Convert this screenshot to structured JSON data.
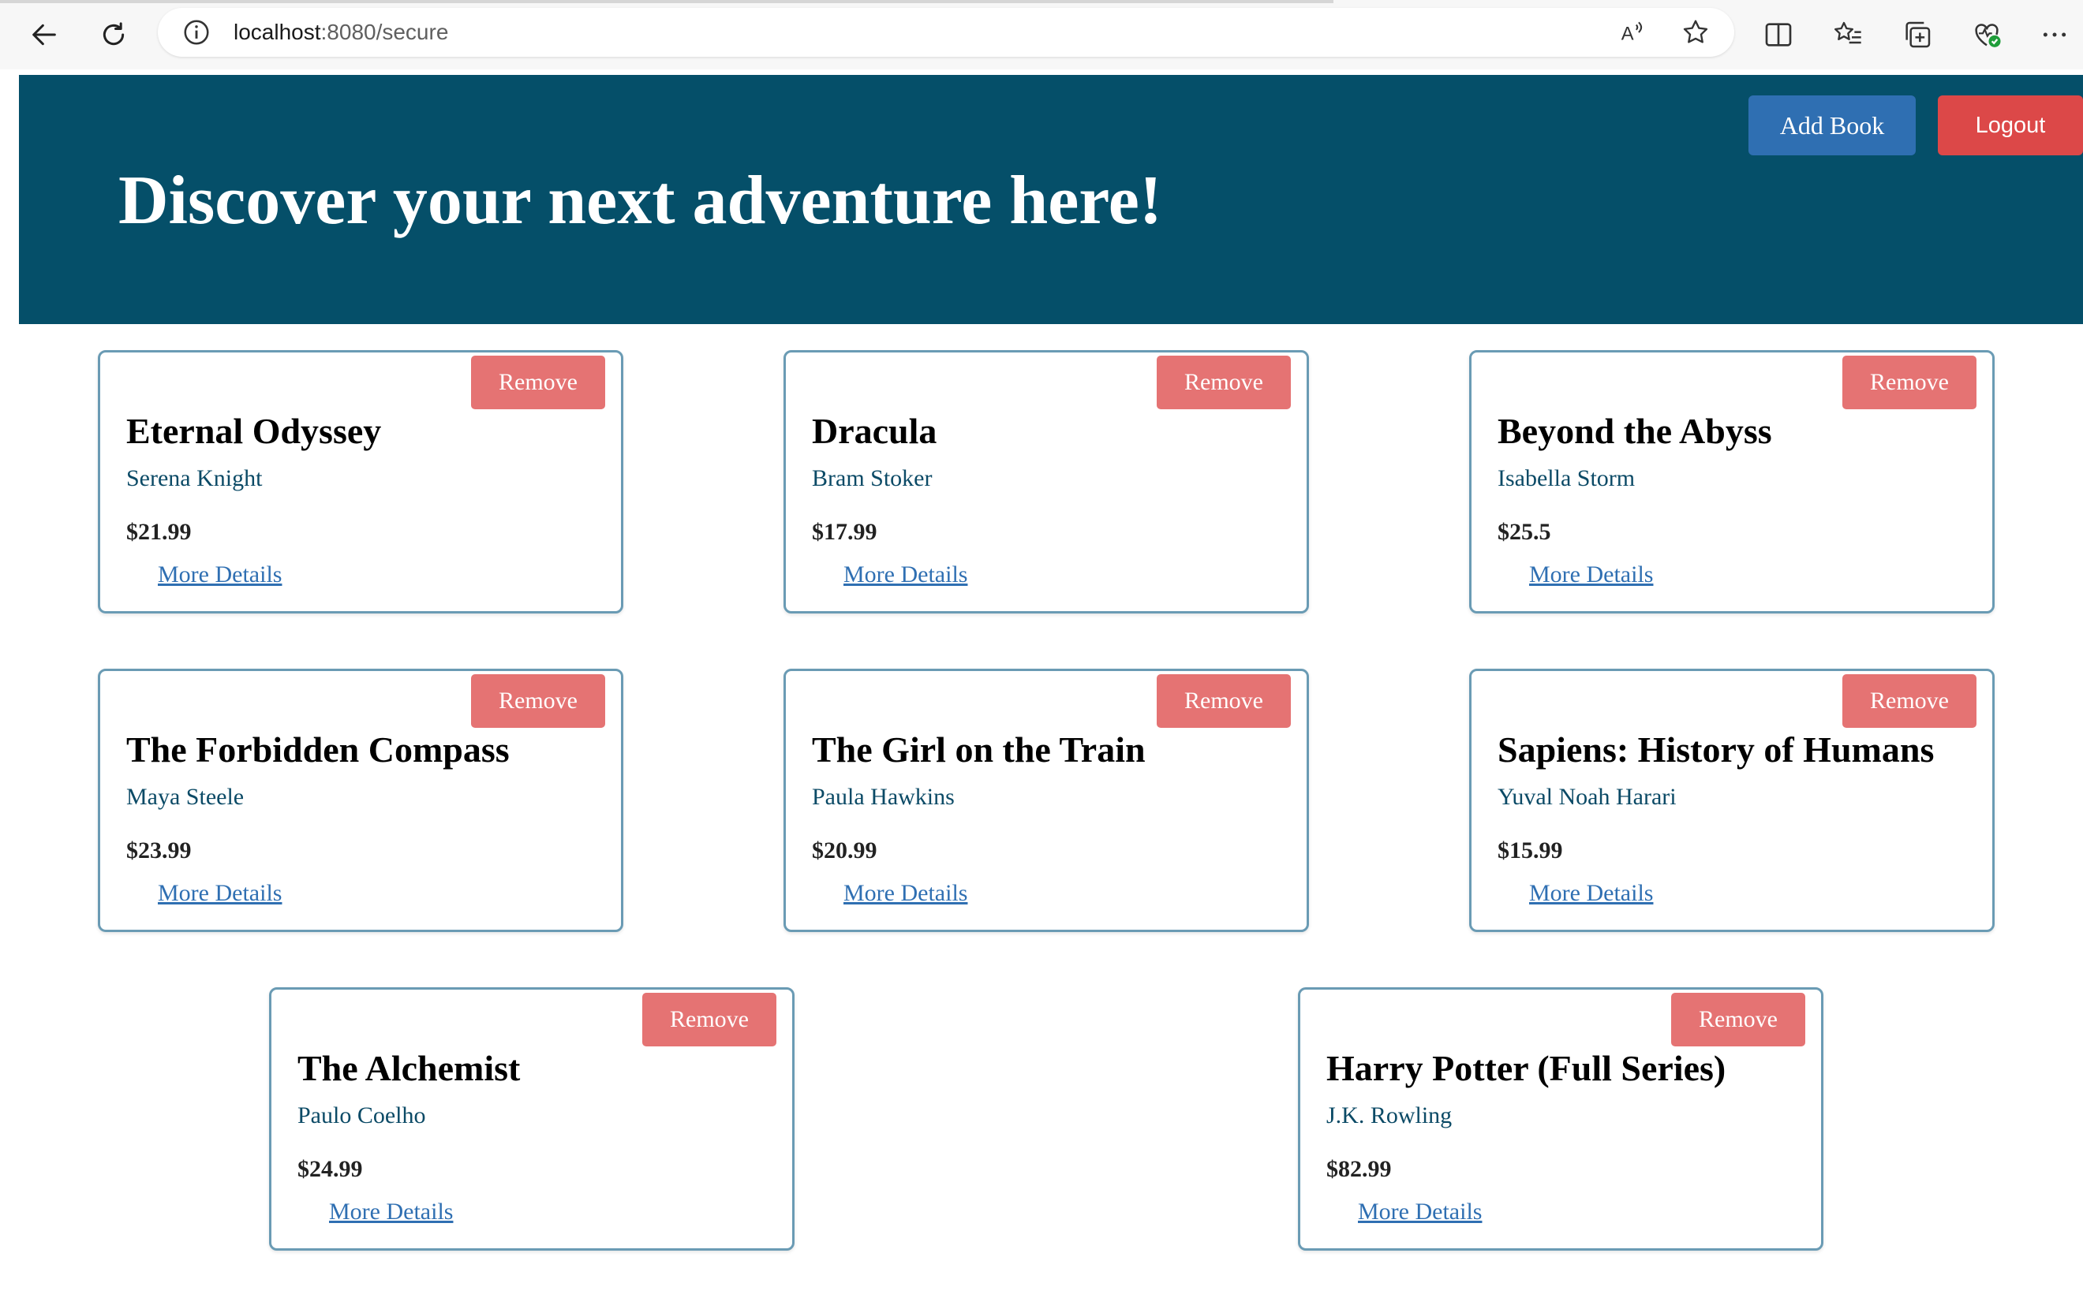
{
  "browser": {
    "url_host": "localhost",
    "url_rest": ":8080/secure",
    "icons": [
      "back-arrow-icon",
      "refresh-icon",
      "info-icon",
      "read-aloud-icon",
      "favorite-star-icon",
      "split-screen-icon",
      "favorites-list-icon",
      "collections-icon",
      "heart-check-icon",
      "more-menu-icon"
    ]
  },
  "header": {
    "title": "Discover your next adventure here!",
    "add_label": "Add Book",
    "logout_label": "Logout",
    "background": "#054f69",
    "add_color": "#2f6fb2",
    "logout_color": "#dc4848"
  },
  "card_labels": {
    "remove": "Remove",
    "more": "More Details",
    "remove_color": "#e57373"
  },
  "books": [
    {
      "title": "Eternal Odyssey",
      "author": "Serena Knight",
      "price": "$21.99"
    },
    {
      "title": "Dracula",
      "author": "Bram Stoker",
      "price": "$17.99"
    },
    {
      "title": "Beyond the Abyss",
      "author": "Isabella Storm",
      "price": "$25.5"
    },
    {
      "title": "The Forbidden Compass",
      "author": "Maya Steele",
      "price": "$23.99"
    },
    {
      "title": "The Girl on the Train",
      "author": "Paula Hawkins",
      "price": "$20.99"
    },
    {
      "title": "Sapiens: History of Humans",
      "author": "Yuval Noah Harari",
      "price": "$15.99"
    },
    {
      "title": "The Alchemist",
      "author": "Paulo Coelho",
      "price": "$24.99"
    },
    {
      "title": "Harry Potter (Full Series)",
      "author": "J.K. Rowling",
      "price": "$82.99"
    }
  ]
}
